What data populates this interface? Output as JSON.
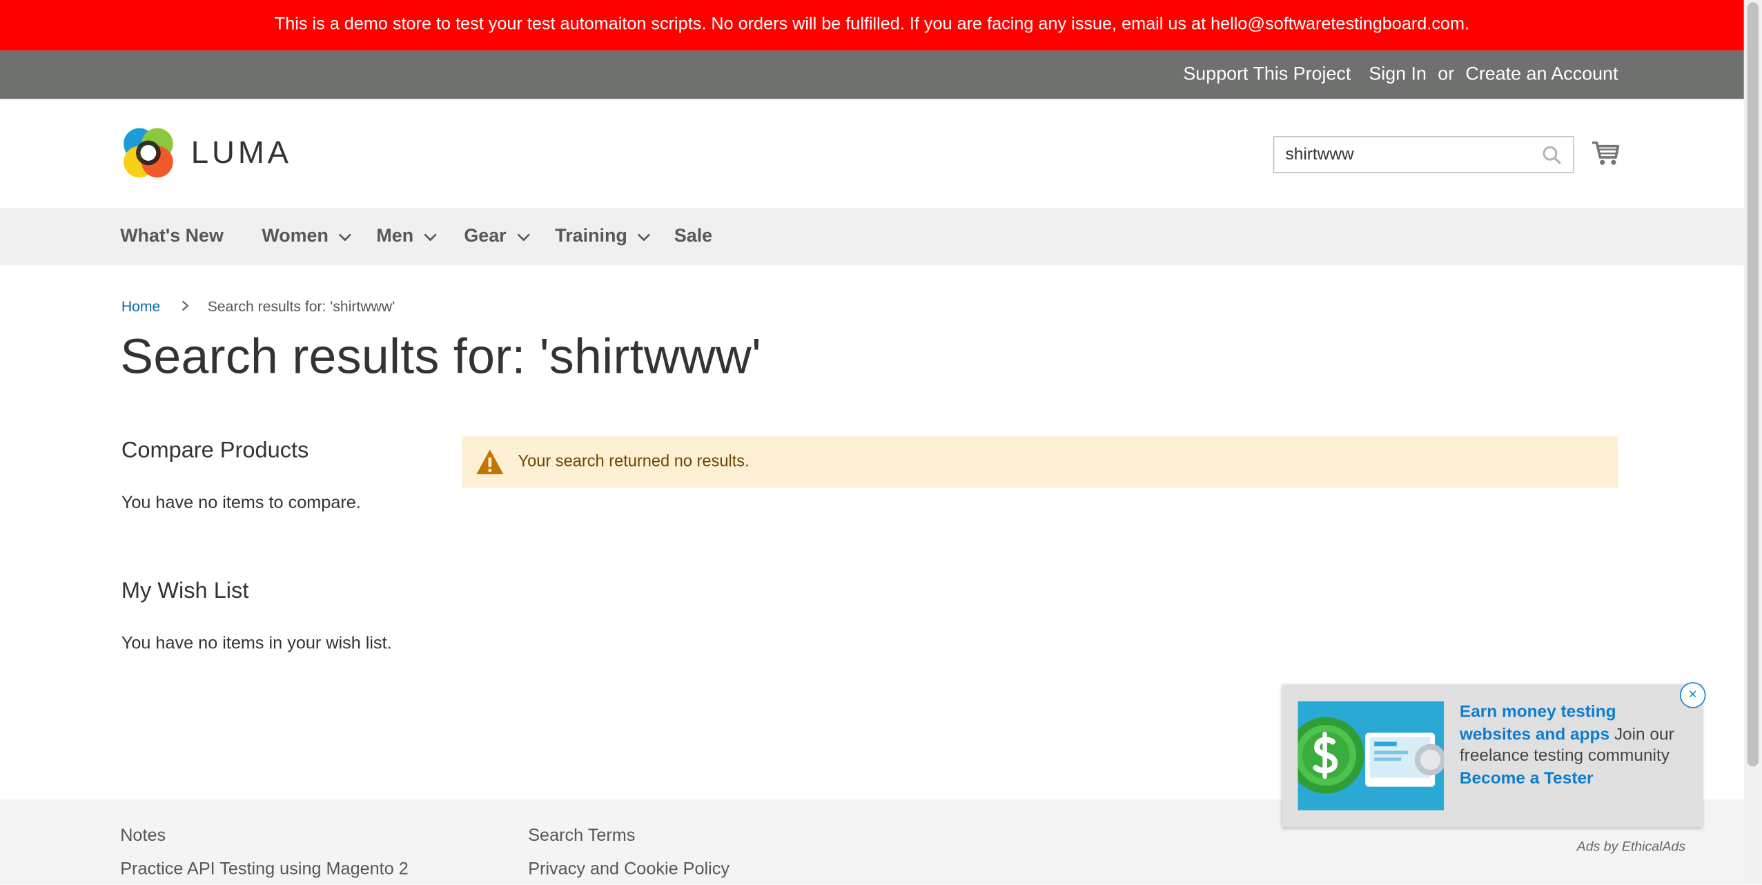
{
  "demo_banner": "This is a demo store to test your test automaiton scripts. No orders will be fulfilled. If you are facing any issue, email us at hello@softwaretestingboard.com.",
  "header": {
    "support": "Support This Project",
    "sign_in": "Sign In",
    "or": "or",
    "create_account": "Create an Account"
  },
  "logo": {
    "text": "LUMA"
  },
  "search": {
    "value": "shirtwww",
    "icon": "search-icon"
  },
  "cart": {
    "icon": "cart-icon"
  },
  "nav": {
    "whats_new": "What's New",
    "women": "Women",
    "men": "Men",
    "gear": "Gear",
    "training": "Training",
    "sale": "Sale"
  },
  "breadcrumb": {
    "home": "Home",
    "current": "Search results for: 'shirtwww'"
  },
  "page_title": "Search results for: 'shirtwww'",
  "sidebar": {
    "compare_title": "Compare Products",
    "compare_empty": "You have no items to compare.",
    "wishlist_title": "My Wish List",
    "wishlist_empty": "You have no items in your wish list."
  },
  "notice": {
    "message": "Your search returned no results.",
    "icon": "warning-icon"
  },
  "footer": {
    "notes": "Notes",
    "api_testing": "Practice API Testing using Magento 2",
    "search_terms": "Search Terms",
    "privacy": "Privacy and Cookie Policy"
  },
  "ad": {
    "headline": "Earn money testing websites and apps",
    "body": "Join our freelance testing community",
    "cta": "Become a Tester",
    "close": "×",
    "attribution": "Ads by EthicalAds"
  },
  "colors": {
    "demo_banner_bg": "#ff0000",
    "header_bg": "#6e716e",
    "nav_bg": "#f0f0f0",
    "notice_bg": "#fdf0d5",
    "link": "#006bb4",
    "ad_link": "#0d7ecf"
  }
}
